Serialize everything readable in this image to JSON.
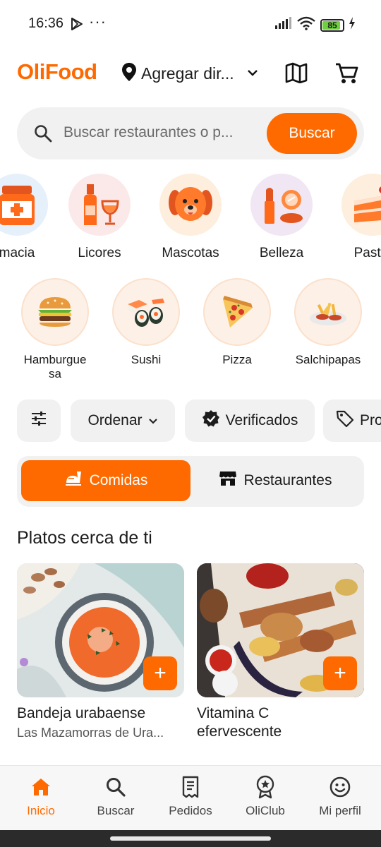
{
  "status_bar": {
    "time": "16:36",
    "dots": "···",
    "battery": "85"
  },
  "header": {
    "logo": "OliFood",
    "address": "Agregar dir..."
  },
  "search": {
    "placeholder": "Buscar restaurantes o p...",
    "button": "Buscar"
  },
  "categories_row1": [
    {
      "label": "macia",
      "icon": "pharmacy-icon"
    },
    {
      "label": "Licores",
      "icon": "liquor-icon"
    },
    {
      "label": "Mascotas",
      "icon": "dog-icon"
    },
    {
      "label": "Belleza",
      "icon": "makeup-icon"
    },
    {
      "label": "Pastel",
      "icon": "cake-icon"
    }
  ],
  "categories_row2": [
    {
      "label_line1": "Hamburgue",
      "label_line2": "sa",
      "icon": "burger-icon"
    },
    {
      "label_line1": "Sushi",
      "label_line2": "",
      "icon": "sushi-icon"
    },
    {
      "label_line1": "Pizza",
      "label_line2": "",
      "icon": "pizza-icon"
    },
    {
      "label_line1": "Salchipapas",
      "label_line2": "",
      "icon": "salchipapas-icon"
    }
  ],
  "filters": {
    "order": "Ordenar",
    "verified": "Verificados",
    "promo": "Pro"
  },
  "tabs": {
    "food": "Comidas",
    "restaurants": "Restaurantes"
  },
  "section_title": "Platos cerca de ti",
  "cards": [
    {
      "title": "Bandeja urabaense",
      "subtitle": "Las Mazamorras de Ura..."
    },
    {
      "title_line1": "Vitamina C",
      "title_line2": "efervescente"
    }
  ],
  "bottom_nav": [
    {
      "label": "Inicio",
      "icon": "home-icon",
      "active": true
    },
    {
      "label": "Buscar",
      "icon": "search-icon"
    },
    {
      "label": "Pedidos",
      "icon": "receipt-icon"
    },
    {
      "label": "OliClub",
      "icon": "badge-icon"
    },
    {
      "label": "Mi perfil",
      "icon": "smiley-icon"
    }
  ],
  "colors": {
    "accent": "#ff6a00",
    "chip_bg": "#f1f1f1"
  }
}
